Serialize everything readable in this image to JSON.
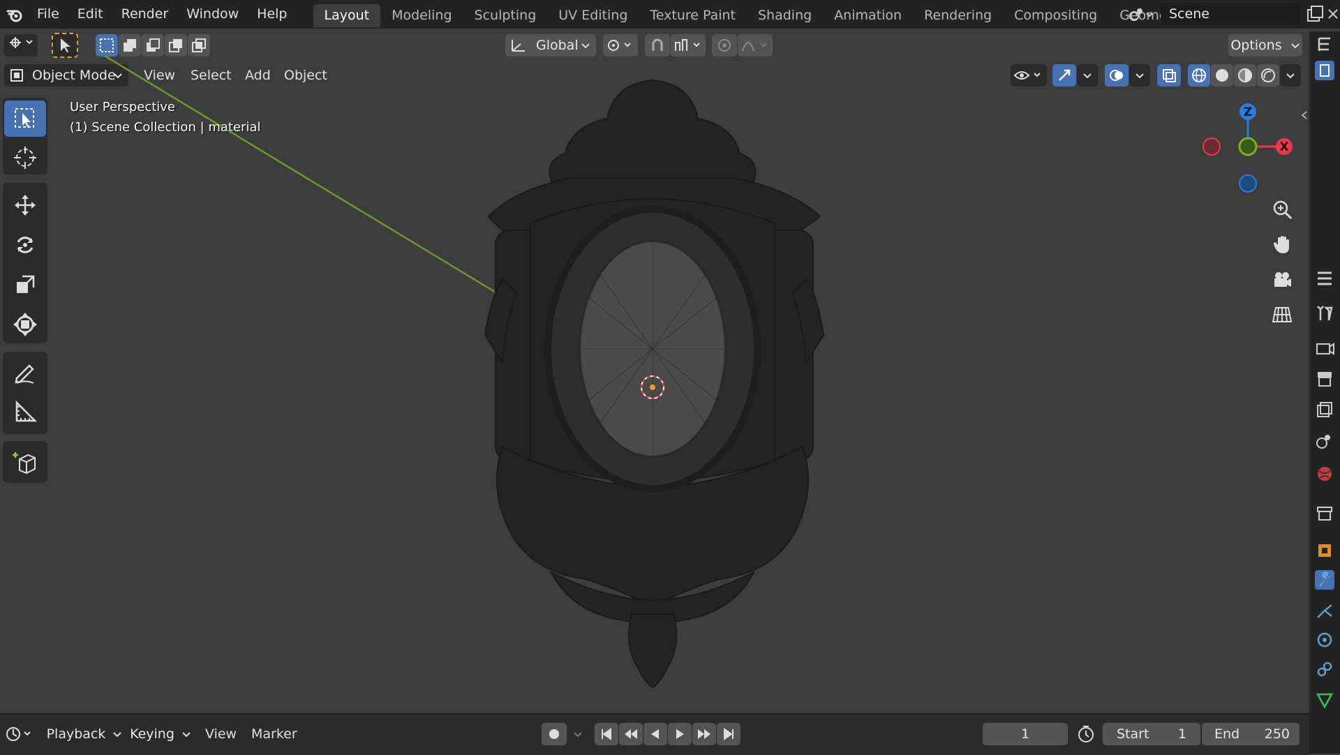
{
  "menus": [
    "File",
    "Edit",
    "Render",
    "Window",
    "Help"
  ],
  "workspaces": [
    {
      "label": "Layout",
      "active": true
    },
    {
      "label": "Modeling",
      "active": false
    },
    {
      "label": "Sculpting",
      "active": false
    },
    {
      "label": "UV Editing",
      "active": false
    },
    {
      "label": "Texture Paint",
      "active": false
    },
    {
      "label": "Shading",
      "active": false
    },
    {
      "label": "Animation",
      "active": false
    },
    {
      "label": "Rendering",
      "active": false
    },
    {
      "label": "Compositing",
      "active": false
    },
    {
      "label": "Geometry Nod",
      "active": false
    }
  ],
  "scene": "Scene",
  "header": {
    "transform_orientation": "Global",
    "options_label": "Options",
    "mode": "Object Mode",
    "view_menu": [
      "View",
      "Select",
      "Add",
      "Object"
    ]
  },
  "viewport": {
    "perspective": "User Perspective",
    "collection": "(1) Scene Collection | material"
  },
  "gizmo": {
    "z": "Z",
    "x": "X",
    "x_color": "#e8394d",
    "y_color": "#7ab228",
    "z_color": "#2b7cdb"
  },
  "timeline": {
    "menus": [
      "Playback",
      "Keying",
      "View",
      "Marker"
    ],
    "current_frame": "1",
    "start_label": "Start",
    "start": "1",
    "end_label": "End",
    "end": "250"
  },
  "colors": {
    "accent": "#4772b3",
    "header": "#232323",
    "viewport": "#3d3d3d"
  }
}
